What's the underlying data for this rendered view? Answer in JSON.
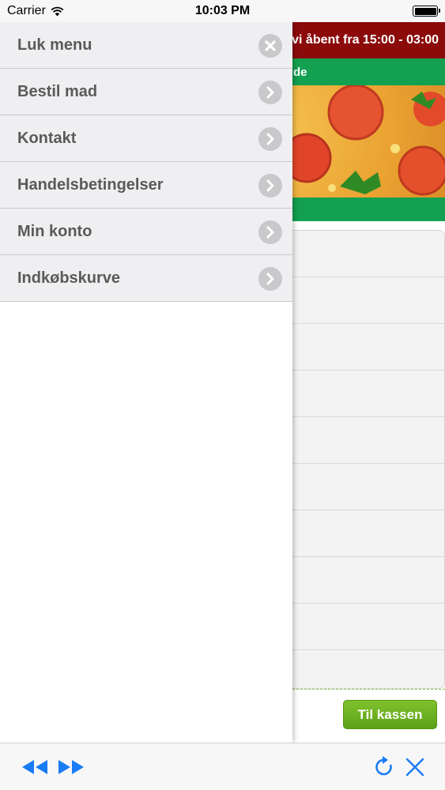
{
  "status_bar": {
    "carrier": "Carrier",
    "time": "10:03 PM"
  },
  "background_page": {
    "hours_text": "vi åbent fra 15:00 - 03:00",
    "green_bar_text": "de",
    "checkout_label": "Til kassen",
    "list_rows": 10
  },
  "menu": {
    "items": [
      {
        "label": "Luk menu",
        "icon": "close-icon"
      },
      {
        "label": "Bestil mad",
        "icon": "chevron-right-icon"
      },
      {
        "label": "Kontakt",
        "icon": "chevron-right-icon"
      },
      {
        "label": "Handelsbetingelser",
        "icon": "chevron-right-icon"
      },
      {
        "label": "Min konto",
        "icon": "chevron-right-icon"
      },
      {
        "label": "Indkøbskurve",
        "icon": "chevron-right-icon"
      }
    ]
  },
  "toolbar": {
    "icons": [
      "rewind-icon",
      "fast-forward-icon",
      "refresh-icon",
      "close-icon"
    ],
    "accent_color": "#1a7cf5"
  },
  "colors": {
    "hours_bar": "#8b0a0a",
    "green_bar": "#13a050",
    "checkout_green": "#6fb224"
  }
}
